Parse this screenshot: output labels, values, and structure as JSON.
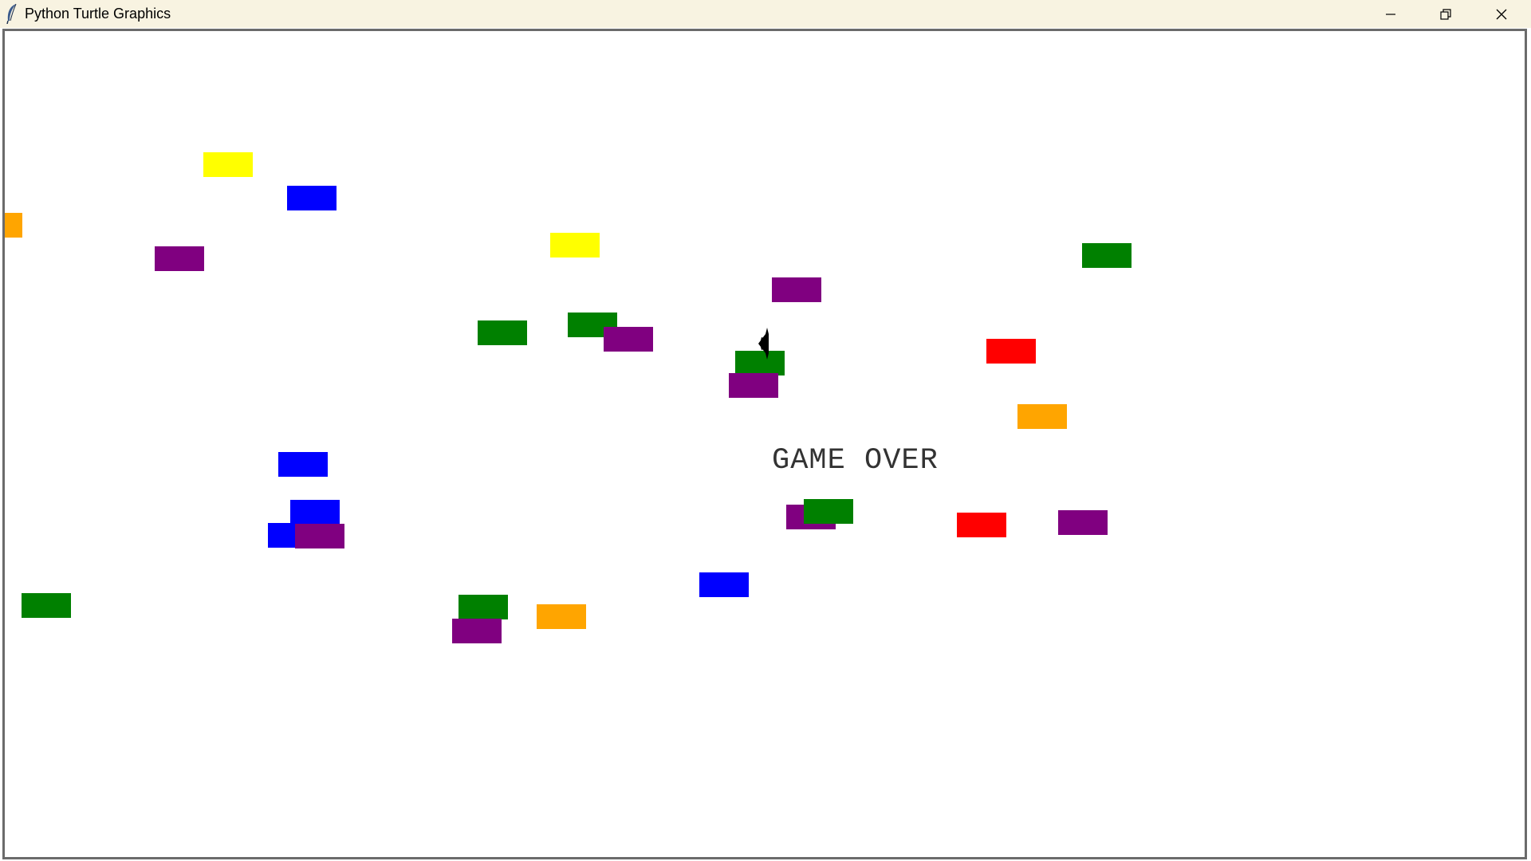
{
  "window": {
    "title": "Python Turtle Graphics",
    "controls": [
      "minimize-icon",
      "restore-icon",
      "close-icon"
    ]
  },
  "canvas": {
    "background": "#ffffff",
    "message": "GAME OVER",
    "message_color": "#333333",
    "turtle": {
      "color": "#000000",
      "shape": "turtle-icon",
      "heading": "left"
    }
  },
  "palette": {
    "yellow": "#ffff00",
    "blue": "#0000ff",
    "orange": "#ffa500",
    "purple": "#800080",
    "green": "#008000",
    "red": "#ff0000"
  },
  "blocks": [
    {
      "name": "block-yellow",
      "color": "yellow"
    },
    {
      "name": "block-blue",
      "color": "blue"
    },
    {
      "name": "block-orange",
      "color": "orange"
    },
    {
      "name": "block-purple",
      "color": "purple"
    },
    {
      "name": "block-yellow",
      "color": "yellow"
    },
    {
      "name": "block-green",
      "color": "green"
    },
    {
      "name": "block-purple",
      "color": "purple"
    },
    {
      "name": "block-green",
      "color": "green"
    },
    {
      "name": "block-green",
      "color": "green"
    },
    {
      "name": "block-purple",
      "color": "purple"
    },
    {
      "name": "block-red",
      "color": "red"
    },
    {
      "name": "block-green",
      "color": "green"
    },
    {
      "name": "block-purple",
      "color": "purple"
    },
    {
      "name": "block-orange",
      "color": "orange"
    },
    {
      "name": "block-blue",
      "color": "blue"
    },
    {
      "name": "block-blue",
      "color": "blue"
    },
    {
      "name": "block-purple",
      "color": "purple"
    },
    {
      "name": "block-green",
      "color": "green"
    },
    {
      "name": "block-blue",
      "color": "blue"
    },
    {
      "name": "block-purple",
      "color": "purple"
    },
    {
      "name": "block-red",
      "color": "red"
    },
    {
      "name": "block-purple",
      "color": "purple"
    },
    {
      "name": "block-blue",
      "color": "blue"
    },
    {
      "name": "block-green",
      "color": "green"
    },
    {
      "name": "block-green",
      "color": "green"
    },
    {
      "name": "block-purple",
      "color": "purple"
    },
    {
      "name": "block-orange",
      "color": "orange"
    }
  ]
}
